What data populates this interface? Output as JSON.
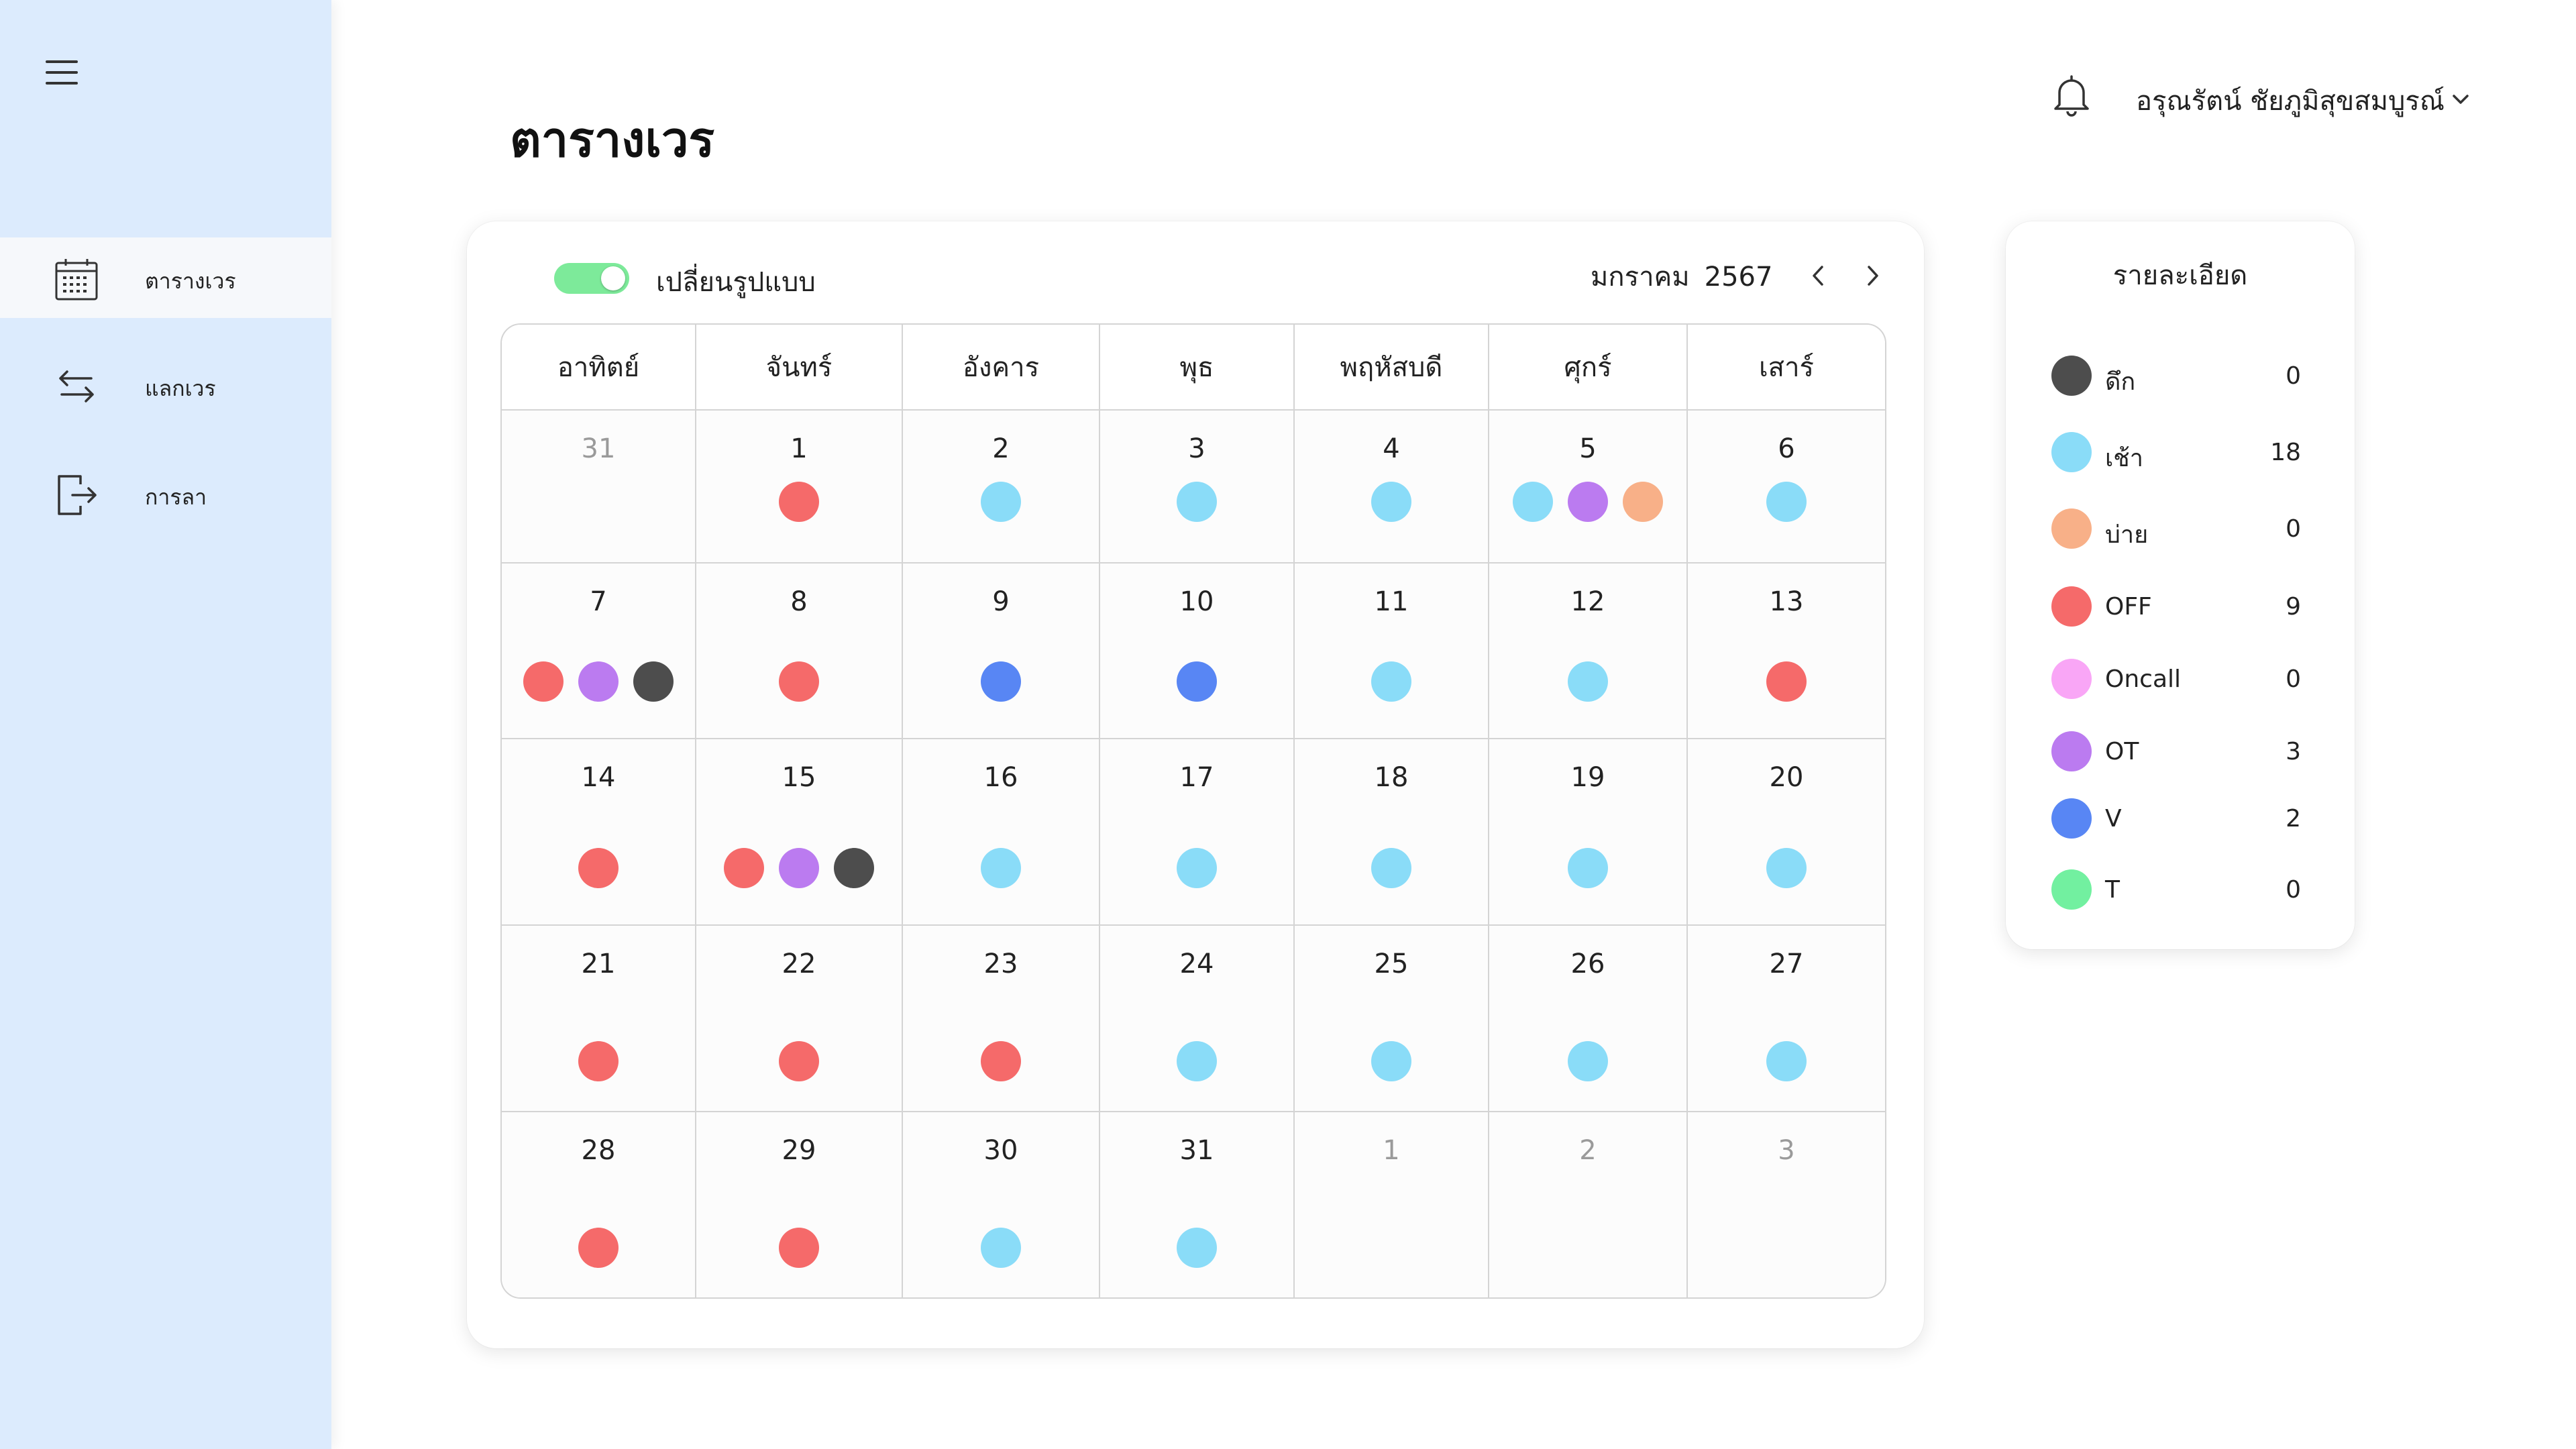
{
  "sidebar": {
    "items": [
      {
        "label": "ตารางเวร",
        "icon": "calendar-icon",
        "active": true
      },
      {
        "label": "แลกเวร",
        "icon": "swap-arrows-icon",
        "active": false
      },
      {
        "label": "การลา",
        "icon": "logout-icon",
        "active": false
      }
    ]
  },
  "header": {
    "title": "ตารางเวร",
    "user_name": "อรุณรัตน์ ชัยภูมิสุขสมบูรณ์"
  },
  "calendar": {
    "toggle_label": "เปลี่ยนรูปแบบ",
    "toggle_on": true,
    "month": "มกราคม",
    "year": "2567",
    "weekdays": [
      "อาทิตย์",
      "จันทร์",
      "อังคาร",
      "พุธ",
      "พฤหัสบดี",
      "ศุกร์",
      "เสาร์"
    ],
    "weeks": [
      [
        {
          "day": "31",
          "muted": true,
          "shifts": []
        },
        {
          "day": "1",
          "shifts": [
            "OFF"
          ]
        },
        {
          "day": "2",
          "shifts": [
            "เช้า"
          ]
        },
        {
          "day": "3",
          "shifts": [
            "เช้า"
          ]
        },
        {
          "day": "4",
          "shifts": [
            "เช้า"
          ]
        },
        {
          "day": "5",
          "shifts": [
            "เช้า",
            "OT",
            "บ่าย"
          ]
        },
        {
          "day": "6",
          "shifts": [
            "เช้า"
          ]
        }
      ],
      [
        {
          "day": "7",
          "shifts": [
            "OFF",
            "OT",
            "ดึก"
          ]
        },
        {
          "day": "8",
          "shifts": [
            "OFF"
          ]
        },
        {
          "day": "9",
          "shifts": [
            "V"
          ]
        },
        {
          "day": "10",
          "shifts": [
            "V"
          ]
        },
        {
          "day": "11",
          "shifts": [
            "เช้า"
          ]
        },
        {
          "day": "12",
          "shifts": [
            "เช้า"
          ]
        },
        {
          "day": "13",
          "shifts": [
            "OFF"
          ]
        }
      ],
      [
        {
          "day": "14",
          "shifts": [
            "OFF"
          ]
        },
        {
          "day": "15",
          "shifts": [
            "OFF",
            "OT",
            "ดึก"
          ]
        },
        {
          "day": "16",
          "shifts": [
            "เช้า"
          ]
        },
        {
          "day": "17",
          "shifts": [
            "เช้า"
          ]
        },
        {
          "day": "18",
          "shifts": [
            "เช้า"
          ]
        },
        {
          "day": "19",
          "shifts": [
            "เช้า"
          ]
        },
        {
          "day": "20",
          "shifts": [
            "เช้า"
          ]
        }
      ],
      [
        {
          "day": "21",
          "shifts": [
            "OFF"
          ]
        },
        {
          "day": "22",
          "shifts": [
            "OFF"
          ]
        },
        {
          "day": "23",
          "shifts": [
            "OFF"
          ]
        },
        {
          "day": "24",
          "shifts": [
            "เช้า"
          ]
        },
        {
          "day": "25",
          "shifts": [
            "เช้า"
          ]
        },
        {
          "day": "26",
          "shifts": [
            "เช้า"
          ]
        },
        {
          "day": "27",
          "shifts": [
            "เช้า"
          ]
        }
      ],
      [
        {
          "day": "28",
          "shifts": [
            "OFF"
          ]
        },
        {
          "day": "29",
          "shifts": [
            "OFF"
          ]
        },
        {
          "day": "30",
          "shifts": [
            "เช้า"
          ]
        },
        {
          "day": "31",
          "shifts": [
            "เช้า"
          ]
        },
        {
          "day": "1",
          "muted": true,
          "shifts": []
        },
        {
          "day": "2",
          "muted": true,
          "shifts": []
        },
        {
          "day": "3",
          "muted": true,
          "shifts": []
        }
      ]
    ]
  },
  "details": {
    "title": "รายละเอียด",
    "items": [
      {
        "label": "ดึก",
        "count": "0",
        "color": "#4d4d4d"
      },
      {
        "label": "เช้า",
        "count": "18",
        "color": "#8adcf8"
      },
      {
        "label": "บ่าย",
        "count": "0",
        "color": "#f8b088"
      },
      {
        "label": "OFF",
        "count": "9",
        "color": "#f56a6a"
      },
      {
        "label": "Oncall",
        "count": "0",
        "color": "#f9a6f6"
      },
      {
        "label": "OT",
        "count": "3",
        "color": "#bb7bf0"
      },
      {
        "label": "V",
        "count": "2",
        "color": "#5886f4"
      },
      {
        "label": "T",
        "count": "0",
        "color": "#72f0a0"
      }
    ]
  }
}
